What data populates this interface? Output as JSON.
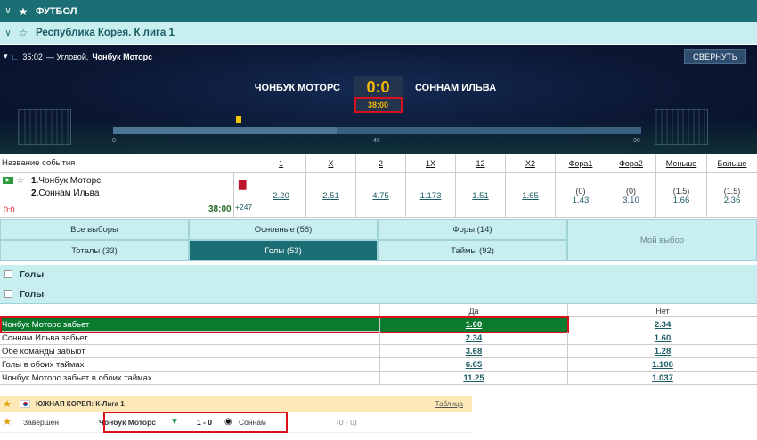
{
  "sport": {
    "title": "ФУТБОЛ"
  },
  "league": {
    "title": "Республика Корея. К лига 1"
  },
  "match": {
    "event_time": "35:02",
    "event_text": "— Угловой,",
    "event_team": "Чонбук Моторс",
    "collapse_label": "СВЕРНУТЬ",
    "team_home": "ЧОНБУК МОТОРС",
    "team_away": "СОННАМ ИЛЬВА",
    "score": "0:0",
    "clock": "38:00",
    "ticks": [
      "0",
      "45",
      "90"
    ]
  },
  "odds_table": {
    "name_header": "Название события",
    "headers": [
      "1",
      "X",
      "2",
      "1X",
      "12",
      "X2",
      "Фора1",
      "Фора2",
      "Меньше",
      "Больше"
    ],
    "home_num": "1.",
    "home": "Чонбук Моторс",
    "away_num": "2.",
    "away": "Соннам Ильва",
    "live_score": "0:0",
    "clock": "38:00",
    "more": "+247",
    "values": [
      "2.20",
      "2.51",
      "4.75",
      "1.173",
      "1.51",
      "1.65",
      "1.43",
      "3.10",
      "1.66",
      "2.36"
    ],
    "handicaps": [
      "(0)",
      "(0)",
      "(1.5)",
      "(1.5)"
    ]
  },
  "tabs": {
    "all": "Все выборы",
    "main": "Основные (58)",
    "handicaps": "Форы (14)",
    "totals": "Тоталы (33)",
    "goals": "Голы (53)",
    "halves": "Таймы (92)",
    "my_choice": "Мой выбор"
  },
  "sections": [
    "Голы",
    "Голы"
  ],
  "market": {
    "col_yes": "Да",
    "col_no": "Нет",
    "rows": [
      {
        "name": "Чонбук Моторс забьет",
        "yes": "1.60",
        "no": "2.34"
      },
      {
        "name": "Соннам Ильва забьет",
        "yes": "2.34",
        "no": "1.60"
      },
      {
        "name": "Обе команды забьют",
        "yes": "3.68",
        "no": "1.28"
      },
      {
        "name": "Голы в обоих таймах",
        "yes": "6.65",
        "no": "1.108"
      },
      {
        "name": "Чонбук Моторс забьет в обоих таймах",
        "yes": "11.25",
        "no": "1.037"
      }
    ]
  },
  "korea": {
    "header": "ЮЖНАЯ КОРЕЯ: К-Лига 1",
    "table_link": "Таблица",
    "status": "Завершен",
    "home": "Чонбук Моторс",
    "score": "1 - 0",
    "away": "Соннам",
    "ht": "(0 - 0)"
  },
  "colors": {
    "accent": "#1a6e74",
    "highlight": "#0a7a2f",
    "score": "#f5b800",
    "annotation": "#d9101a"
  }
}
